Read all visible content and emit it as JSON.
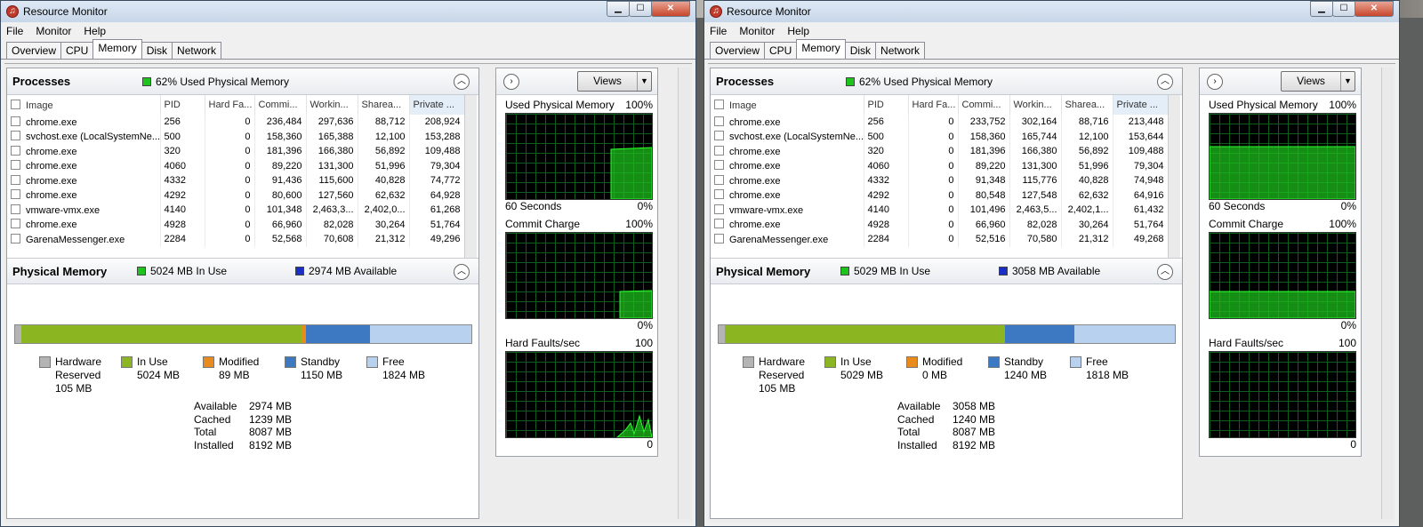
{
  "windows": [
    {
      "title": "Resource Monitor",
      "menu": [
        "File",
        "Monitor",
        "Help"
      ],
      "tabs": [
        "Overview",
        "CPU",
        "Memory",
        "Disk",
        "Network"
      ],
      "processes": {
        "title": "Processes",
        "summary": "62% Used Physical Memory",
        "columns": [
          "Image",
          "PID",
          "Hard Fa...",
          "Commi...",
          "Workin...",
          "Sharea...",
          "Private ..."
        ],
        "rows": [
          [
            "chrome.exe",
            "256",
            "0",
            "236,484",
            "297,636",
            "88,712",
            "208,924"
          ],
          [
            "svchost.exe (LocalSystemNe...",
            "500",
            "0",
            "158,360",
            "165,388",
            "12,100",
            "153,288"
          ],
          [
            "chrome.exe",
            "320",
            "0",
            "181,396",
            "166,380",
            "56,892",
            "109,488"
          ],
          [
            "chrome.exe",
            "4060",
            "0",
            "89,220",
            "131,300",
            "51,996",
            "79,304"
          ],
          [
            "chrome.exe",
            "4332",
            "0",
            "91,436",
            "115,600",
            "40,828",
            "74,772"
          ],
          [
            "chrome.exe",
            "4292",
            "0",
            "80,600",
            "127,560",
            "62,632",
            "64,928"
          ],
          [
            "vmware-vmx.exe",
            "4140",
            "0",
            "101,348",
            "2,463,3...",
            "2,402,0...",
            "61,268"
          ],
          [
            "chrome.exe",
            "4928",
            "0",
            "66,960",
            "82,028",
            "30,264",
            "51,764"
          ],
          [
            "GarenaMessenger.exe",
            "2284",
            "0",
            "52,568",
            "70,608",
            "21,312",
            "49,296"
          ]
        ]
      },
      "physical": {
        "title": "Physical Memory",
        "in_use": "5024 MB In Use",
        "available": "2974 MB Available",
        "bar_fractions": {
          "hardware": 0.013,
          "in_use": 0.614,
          "modified": 0.011,
          "standby": 0.14,
          "free": 0.222
        },
        "legend": [
          {
            "name": "Hardware",
            "sub": "Reserved",
            "value": "105 MB",
            "color": "#b4b4b4"
          },
          {
            "name": "In Use",
            "value": "5024 MB",
            "color": "#8bb521"
          },
          {
            "name": "Modified",
            "value": "89 MB",
            "color": "#e98b1c"
          },
          {
            "name": "Standby",
            "value": "1150 MB",
            "color": "#3d78c3"
          },
          {
            "name": "Free",
            "value": "1824 MB",
            "color": "#b8d1ef"
          }
        ],
        "stats": [
          [
            "Available",
            "2974 MB"
          ],
          [
            "Cached",
            "1239 MB"
          ],
          [
            "Total",
            "8087 MB"
          ],
          [
            "Installed",
            "8192 MB"
          ]
        ]
      },
      "graphs": {
        "views_label": "Views",
        "used": {
          "label": "Used Physical Memory",
          "max": "100%",
          "foot_left": "60 Seconds",
          "foot_right": "0%"
        },
        "commit": {
          "label": "Commit Charge",
          "max": "100%",
          "foot_right": "0%"
        },
        "faults": {
          "label": "Hard Faults/sec",
          "max": "100",
          "foot_right": "0"
        }
      }
    },
    {
      "title": "Resource Monitor",
      "menu": [
        "File",
        "Monitor",
        "Help"
      ],
      "tabs": [
        "Overview",
        "CPU",
        "Memory",
        "Disk",
        "Network"
      ],
      "processes": {
        "title": "Processes",
        "summary": "62% Used Physical Memory",
        "columns": [
          "Image",
          "PID",
          "Hard Fa...",
          "Commi...",
          "Workin...",
          "Sharea...",
          "Private ..."
        ],
        "rows": [
          [
            "chrome.exe",
            "256",
            "0",
            "233,752",
            "302,164",
            "88,716",
            "213,448"
          ],
          [
            "svchost.exe (LocalSystemNe...",
            "500",
            "0",
            "158,360",
            "165,744",
            "12,100",
            "153,644"
          ],
          [
            "chrome.exe",
            "320",
            "0",
            "181,396",
            "166,380",
            "56,892",
            "109,488"
          ],
          [
            "chrome.exe",
            "4060",
            "0",
            "89,220",
            "131,300",
            "51,996",
            "79,304"
          ],
          [
            "chrome.exe",
            "4332",
            "0",
            "91,348",
            "115,776",
            "40,828",
            "74,948"
          ],
          [
            "chrome.exe",
            "4292",
            "0",
            "80,548",
            "127,548",
            "62,632",
            "64,916"
          ],
          [
            "vmware-vmx.exe",
            "4140",
            "0",
            "101,496",
            "2,463,5...",
            "2,402,1...",
            "61,432"
          ],
          [
            "chrome.exe",
            "4928",
            "0",
            "66,960",
            "82,028",
            "30,264",
            "51,764"
          ],
          [
            "GarenaMessenger.exe",
            "2284",
            "0",
            "52,516",
            "70,580",
            "21,312",
            "49,268"
          ]
        ]
      },
      "physical": {
        "title": "Physical Memory",
        "in_use": "5029 MB In Use",
        "available": "3058 MB Available",
        "bar_fractions": {
          "hardware": 0.013,
          "in_use": 0.614,
          "modified": 0.0,
          "standby": 0.152,
          "free": 0.221
        },
        "legend": [
          {
            "name": "Hardware",
            "sub": "Reserved",
            "value": "105 MB",
            "color": "#b4b4b4"
          },
          {
            "name": "In Use",
            "value": "5029 MB",
            "color": "#8bb521"
          },
          {
            "name": "Modified",
            "value": "0 MB",
            "color": "#e98b1c"
          },
          {
            "name": "Standby",
            "value": "1240 MB",
            "color": "#3d78c3"
          },
          {
            "name": "Free",
            "value": "1818 MB",
            "color": "#b8d1ef"
          }
        ],
        "stats": [
          [
            "Available",
            "3058 MB"
          ],
          [
            "Cached",
            "1240 MB"
          ],
          [
            "Total",
            "8087 MB"
          ],
          [
            "Installed",
            "8192 MB"
          ]
        ]
      },
      "graphs": {
        "views_label": "Views",
        "used": {
          "label": "Used Physical Memory",
          "max": "100%",
          "foot_left": "60 Seconds",
          "foot_right": "0%"
        },
        "commit": {
          "label": "Commit Charge",
          "max": "100%",
          "foot_right": "0%"
        },
        "faults": {
          "label": "Hard Faults/sec",
          "max": "100",
          "foot_right": "0"
        }
      }
    }
  ]
}
